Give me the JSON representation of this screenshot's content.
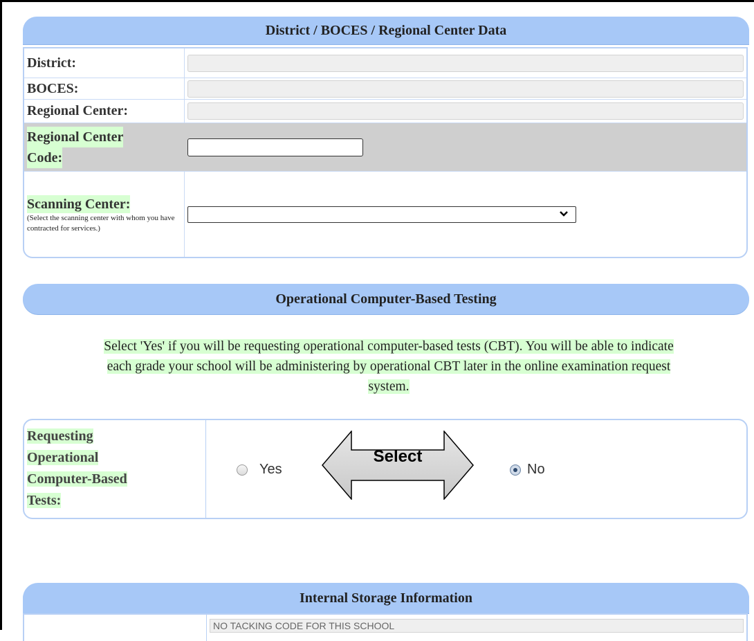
{
  "district_section": {
    "title": "District / BOCES / Regional Center Data",
    "district_label": "District:",
    "boces_label": "BOCES:",
    "regional_center_label": "Regional Center:",
    "regional_center_code_label_1": "Regional Center",
    "regional_center_code_label_2": "Code:",
    "regional_center_code_value": "",
    "scanning_center_label": "Scanning Center:",
    "scanning_center_note": "(Select the scanning center with whom you have contracted for services.)",
    "scanning_center_value": ""
  },
  "cbt_section": {
    "title": "Operational Computer-Based Testing",
    "info_line_1": "Select 'Yes' if you will be requesting operational computer-based tests (CBT). You will be able to indicate",
    "info_line_2": "each grade your school will be administering by operational CBT later in the online examination request",
    "info_line_3": "system.",
    "label_lines": [
      "Requesting",
      "Operational",
      "Computer-Based",
      "Tests:"
    ],
    "yes_label": "Yes",
    "no_label": "No",
    "selected": "No",
    "callout_text": "Select"
  },
  "storage_section": {
    "title": "Internal Storage Information",
    "field_value": "NO TACKING CODE FOR THIS SCHOOL"
  }
}
